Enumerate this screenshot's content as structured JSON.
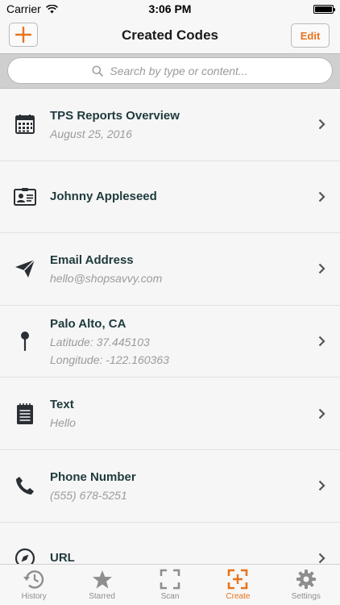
{
  "status_bar": {
    "carrier": "Carrier",
    "time": "3:06 PM"
  },
  "nav": {
    "title": "Created Codes",
    "edit_label": "Edit"
  },
  "search": {
    "placeholder": "Search by type or content..."
  },
  "rows": [
    {
      "title": "TPS Reports Overview",
      "subtitle": "August 25, 2016",
      "icon": "calendar-icon"
    },
    {
      "title": "Johnny Appleseed",
      "icon": "contact-card-icon"
    },
    {
      "title": "Email Address",
      "subtitle": "hello@shopsavvy.com",
      "icon": "paper-plane-icon"
    },
    {
      "title": "Palo Alto, CA",
      "subtitle": "Latitude: 37.445103",
      "subtitle2": "Longitude: -122.160363",
      "icon": "map-pin-icon"
    },
    {
      "title": "Text",
      "subtitle": "Hello",
      "icon": "notepad-icon"
    },
    {
      "title": "Phone Number",
      "subtitle": "(555) 678-5251",
      "icon": "phone-icon"
    },
    {
      "title": "URL",
      "icon": "compass-icon"
    }
  ],
  "tabs": [
    {
      "label": "History",
      "icon": "history-icon"
    },
    {
      "label": "Starred",
      "icon": "star-icon"
    },
    {
      "label": "Scan",
      "icon": "scan-icon"
    },
    {
      "label": "Create",
      "icon": "create-icon",
      "active": true
    },
    {
      "label": "Settings",
      "icon": "gear-icon"
    }
  ],
  "colors": {
    "accent": "#e8731d",
    "title_text": "#1f3a3d",
    "subtitle_text": "#9b9b9b",
    "tab_inactive": "#8e8e8e"
  }
}
